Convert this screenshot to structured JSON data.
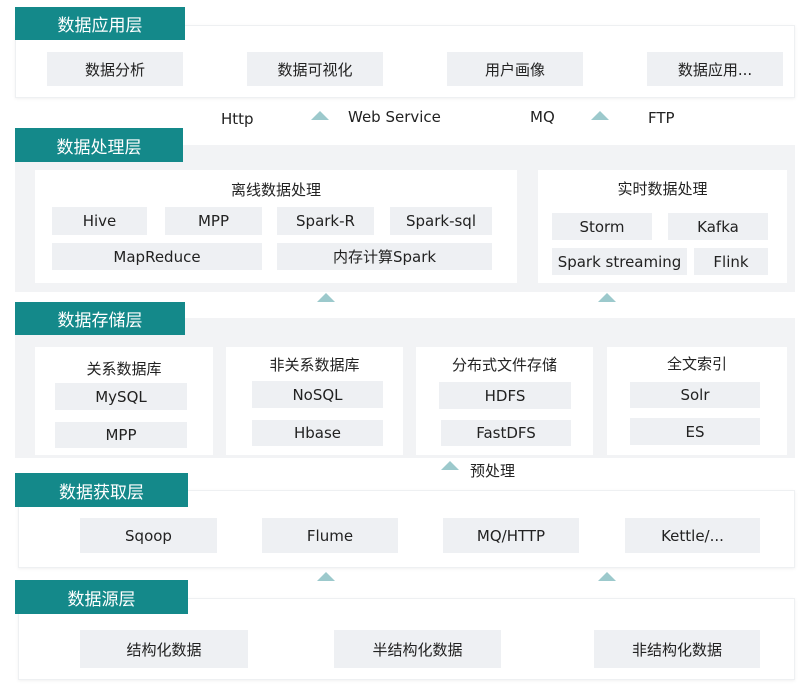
{
  "colors": {
    "accent": "#14898a",
    "arrow": "#9cc9cc",
    "item_bg": "#eef0f3",
    "panel_bg": "#f2f3f5"
  },
  "icons": {
    "flow_arrow": "arrow-up-icon"
  },
  "app_layer": {
    "label": "数据应用层",
    "items": [
      "数据分析",
      "数据可视化",
      "用户画像",
      "数据应用..."
    ]
  },
  "protocols": [
    "Http",
    "Web Service",
    "MQ",
    "FTP"
  ],
  "processing_layer": {
    "label": "数据处理层",
    "offline": {
      "title": "离线数据处理",
      "items": [
        "Hive",
        "MPP",
        "Spark-R",
        "Spark-sql",
        "MapReduce",
        "内存计算Spark"
      ]
    },
    "realtime": {
      "title": "实时数据处理",
      "items": [
        "Storm",
        "Kafka",
        "Spark streaming",
        "Flink"
      ]
    }
  },
  "storage_layer": {
    "label": "数据存储层",
    "groups": [
      {
        "title": "关系数据库",
        "items": [
          "MySQL",
          "MPP"
        ]
      },
      {
        "title": "非关系数据库",
        "items": [
          "NoSQL",
          "Hbase"
        ]
      },
      {
        "title": "分布式文件存储",
        "items": [
          "HDFS",
          "FastDFS"
        ]
      },
      {
        "title": "全文索引",
        "items": [
          "Solr",
          "ES"
        ]
      }
    ]
  },
  "preprocess_label": "预处理",
  "acquisition_layer": {
    "label": "数据获取层",
    "items": [
      "Sqoop",
      "Flume",
      "MQ/HTTP",
      "Kettle/..."
    ]
  },
  "source_layer": {
    "label": "数据源层",
    "items": [
      "结构化数据",
      "半结构化数据",
      "非结构化数据"
    ]
  }
}
